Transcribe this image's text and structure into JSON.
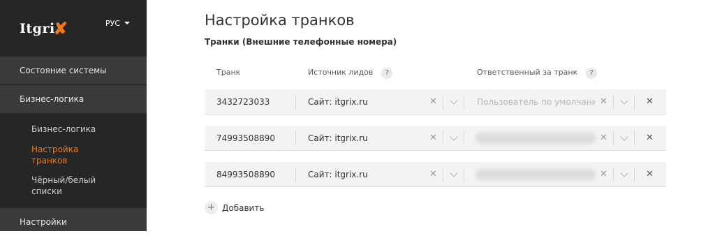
{
  "sidebar": {
    "logo_text": "Itgri",
    "logo_mark": "✘",
    "lang": "РУС",
    "items": [
      {
        "label": "Состояние системы"
      },
      {
        "label": "Бизнес-логика"
      },
      {
        "label": "Настройки"
      }
    ],
    "sub_items": [
      {
        "label": "Бизнес-логика",
        "active": false
      },
      {
        "label": "Настройка транков",
        "active": true
      },
      {
        "label": "Чёрный/белый списки",
        "active": false
      }
    ]
  },
  "main": {
    "title": "Настройка транков",
    "subtitle": "Транки (Внешние телефонные номера)",
    "columns": {
      "trunk": "Транк",
      "source": "Источник лидов",
      "responsible": "Ответственный за транк",
      "help": "?"
    },
    "rows": [
      {
        "number": "3432723033",
        "source": "Сайт: itgrix.ru",
        "responsible_placeholder": "Пользователь по умолчани"
      },
      {
        "number": "74993508890",
        "source": "Сайт: itgrix.ru"
      },
      {
        "number": "84993508890",
        "source": "Сайт: itgrix.ru"
      }
    ],
    "clear_glyph": "✕",
    "add_glyph": "+",
    "add_label": "Добавить"
  },
  "colors": {
    "accent": "#f07a1a",
    "sidebar_bg": "#262626",
    "nav_item_bg": "#3a3a3a"
  }
}
